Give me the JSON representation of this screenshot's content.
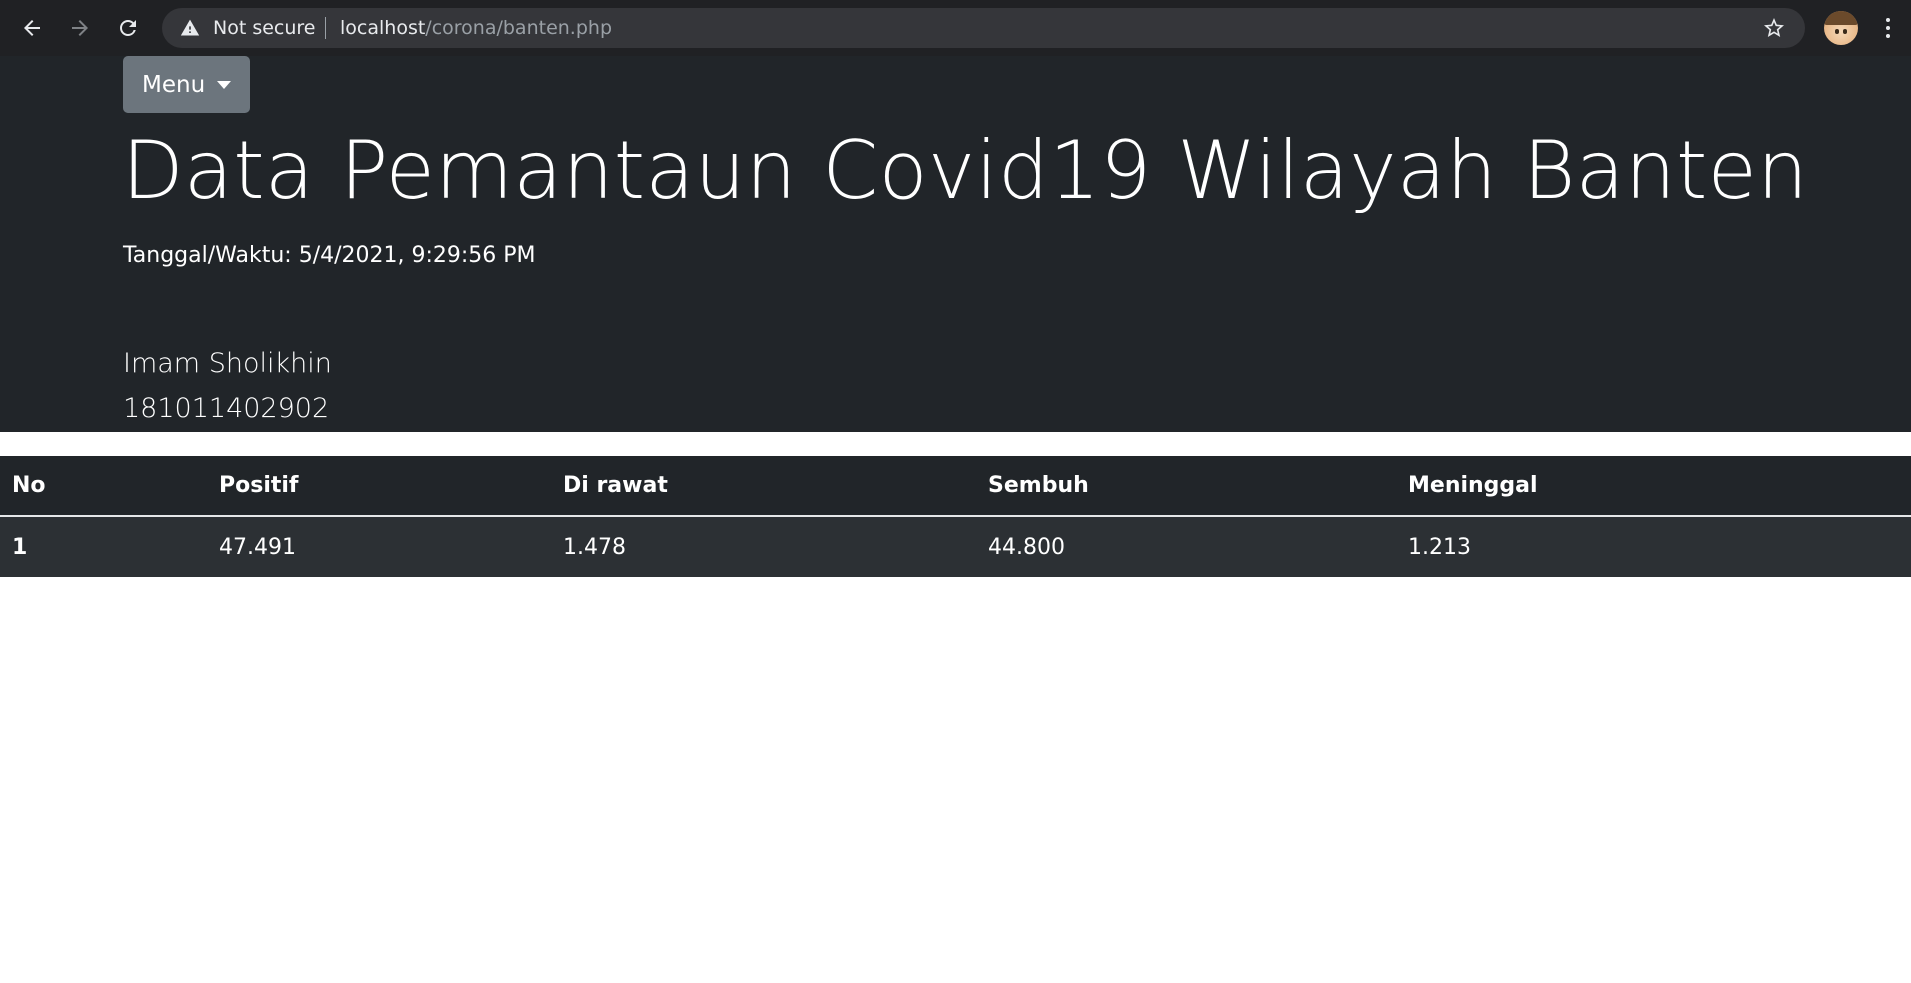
{
  "browser": {
    "security_label": "Not secure",
    "url_host": "localhost",
    "url_path": "/corona/banten.php"
  },
  "header": {
    "menu_label": "Menu",
    "title": "Data Pemantaun Covid19 Wilayah Banten",
    "timestamp": "Tanggal/Waktu: 5/4/2021, 9:29:56 PM",
    "author_name": "Imam Sholikhin",
    "author_id": "181011402902"
  },
  "table": {
    "columns": [
      "No",
      "Positif",
      "Di rawat",
      "Sembuh",
      "Meninggal"
    ],
    "rows": [
      [
        "1",
        "47.491",
        "1.478",
        "44.800",
        "1.213"
      ]
    ]
  },
  "colors": {
    "chrome_bg": "#202124",
    "omnibox_bg": "#35363a",
    "jumbotron_bg": "#212529",
    "button_secondary": "#6c757d",
    "table_row_bg": "#2c3034"
  },
  "icons": [
    "back-arrow-icon",
    "forward-arrow-icon",
    "reload-icon",
    "warning-icon",
    "star-icon",
    "profile-avatar",
    "more-vert-icon",
    "caret-down-icon"
  ]
}
